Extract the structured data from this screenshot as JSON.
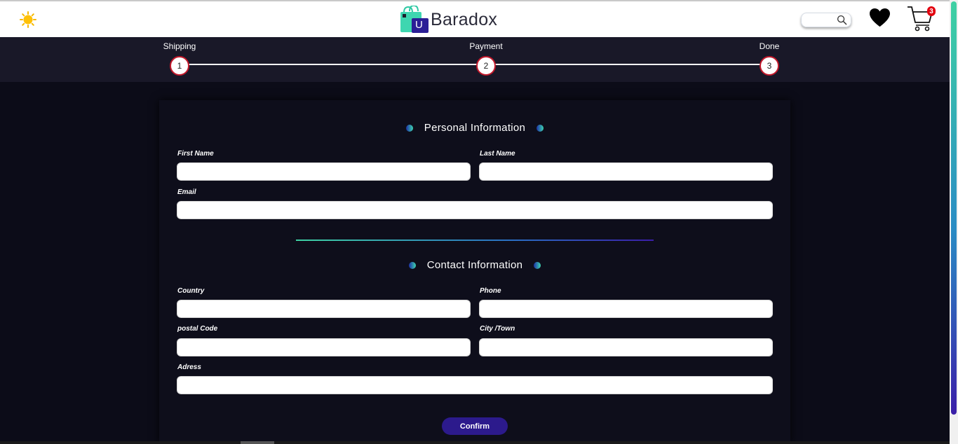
{
  "header": {
    "brand": "Baradox",
    "logo_letter": "U",
    "cart_count": "3",
    "search": {
      "placeholder": "",
      "value": ""
    }
  },
  "steps": [
    {
      "label": "Shipping",
      "number": "1"
    },
    {
      "label": "Payment",
      "number": "2"
    },
    {
      "label": "Done",
      "number": "3"
    }
  ],
  "personal": {
    "title": "Personal Information",
    "first_name_label": "First Name",
    "last_name_label": "Last Name",
    "email_label": "Email"
  },
  "contact": {
    "title": "Contact Information",
    "country_label": "Country",
    "phone_label": "Phone",
    "postal_label": "postal Code",
    "city_label": "City /Town",
    "address_label": "Adress"
  },
  "confirm_label": "Confirm",
  "colors": {
    "accent": "#2c1a8c",
    "step_border": "#c2182b",
    "badge": "#e3000f",
    "teal": "#3fd1a3"
  }
}
